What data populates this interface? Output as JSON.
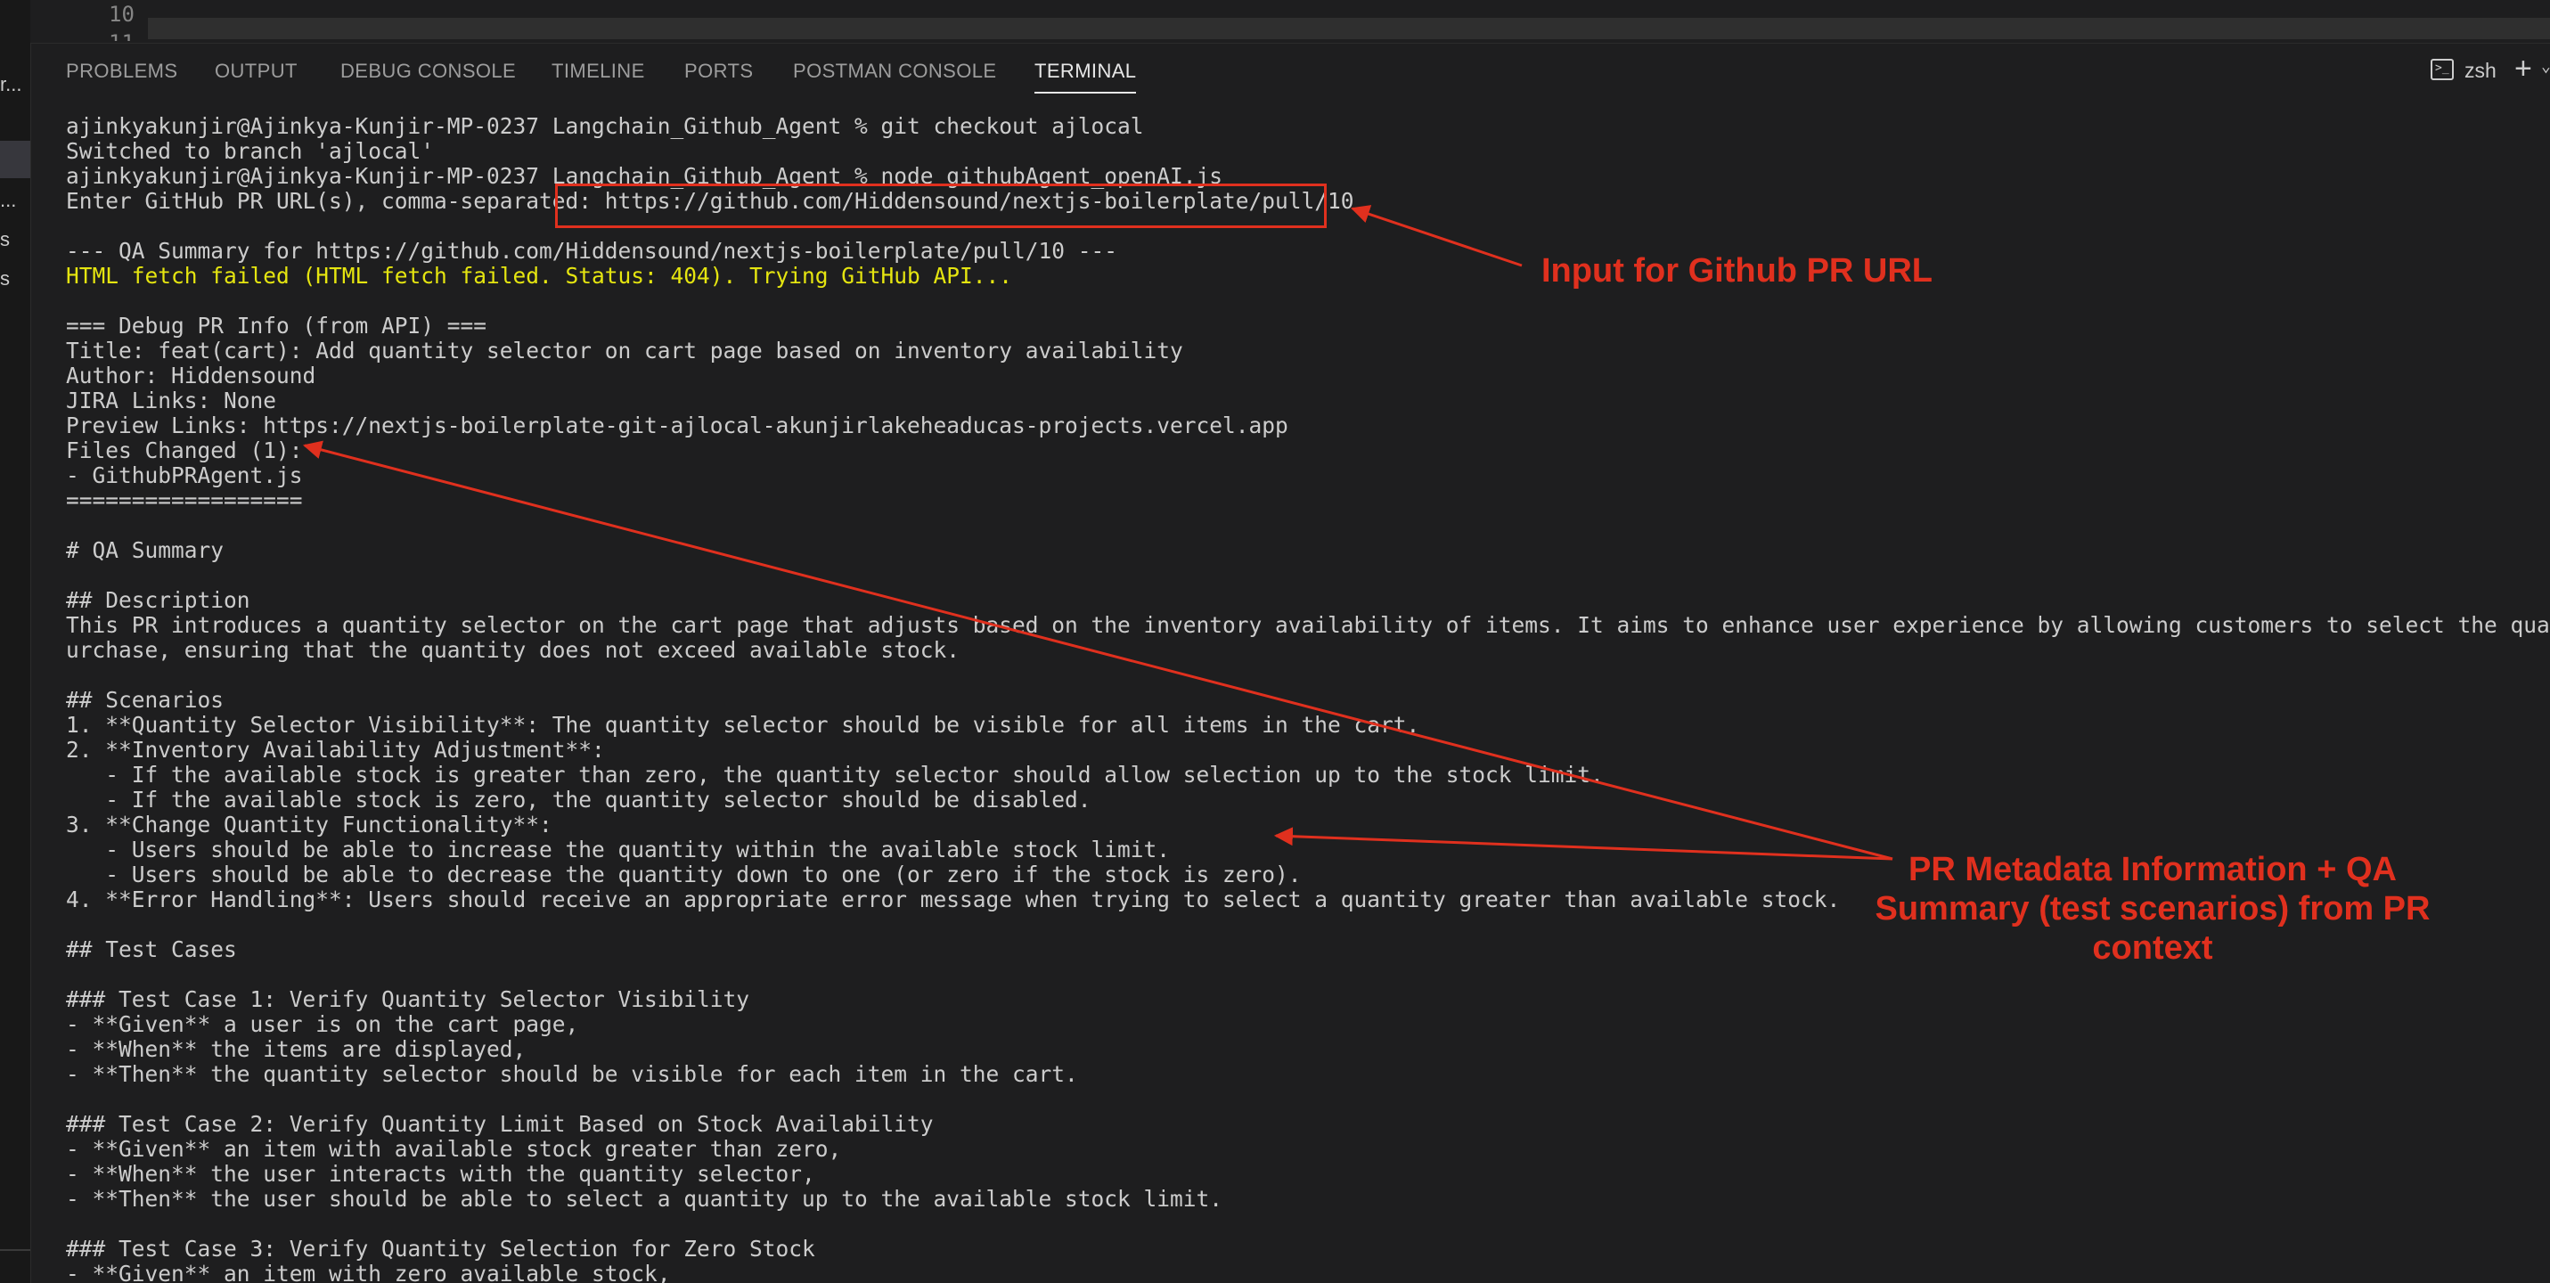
{
  "editor": {
    "line_number": "10",
    "line_number_next": "11"
  },
  "activity_fragments": [
    "r...",
    "...",
    "s",
    "s"
  ],
  "panel": {
    "tabs": [
      "PROBLEMS",
      "OUTPUT",
      "DEBUG CONSOLE",
      "TIMELINE",
      "PORTS",
      "POSTMAN CONSOLE",
      "TERMINAL"
    ],
    "active_tab": "TERMINAL",
    "shell_name": "zsh",
    "shell_icon": "terminal-icon",
    "add_icon": "plus-icon"
  },
  "terminal": {
    "lines": [
      "ajinkyakunjir@Ajinkya-Kunjir-MP-0237 Langchain_Github_Agent % git checkout ajlocal",
      "Switched to branch 'ajlocal'",
      "ajinkyakunjir@Ajinkya-Kunjir-MP-0237 Langchain_Github_Agent % node githubAgent_openAI.js",
      "Enter GitHub PR URL(s), comma-separated: https://github.com/Hiddensound/nextjs-boilerplate/pull/10",
      "",
      "--- QA Summary for https://github.com/Hiddensound/nextjs-boilerplate/pull/10 ---",
      "HTML fetch failed (HTML fetch failed. Status: 404). Trying GitHub API...",
      "",
      "=== Debug PR Info (from API) ===",
      "Title: feat(cart): Add quantity selector on cart page based on inventory availability",
      "Author: Hiddensound",
      "JIRA Links: None",
      "Preview Links: https://nextjs-boilerplate-git-ajlocal-akunjirlakeheaducas-projects.vercel.app",
      "Files Changed (1):",
      "- GithubPRAgent.js",
      "==================",
      "",
      "# QA Summary",
      "",
      "## Description",
      "This PR introduces a quantity selector on the cart page that adjusts based on the inventory availability of items. It aims to enhance user experience by allowing customers to select the quantity of i",
      "urchase, ensuring that the quantity does not exceed available stock.",
      "",
      "## Scenarios",
      "1. **Quantity Selector Visibility**: The quantity selector should be visible for all items in the cart.",
      "2. **Inventory Availability Adjustment**:",
      "   - If the available stock is greater than zero, the quantity selector should allow selection up to the stock limit.",
      "   - If the available stock is zero, the quantity selector should be disabled.",
      "3. **Change Quantity Functionality**:",
      "   - Users should be able to increase the quantity within the available stock limit.",
      "   - Users should be able to decrease the quantity down to one (or zero if the stock is zero).",
      "4. **Error Handling**: Users should receive an appropriate error message when trying to select a quantity greater than available stock.",
      "",
      "## Test Cases",
      "",
      "### Test Case 1: Verify Quantity Selector Visibility",
      "- **Given** a user is on the cart page,",
      "- **When** the items are displayed,",
      "- **Then** the quantity selector should be visible for each item in the cart.",
      "",
      "### Test Case 2: Verify Quantity Limit Based on Stock Availability",
      "- **Given** an item with available stock greater than zero,",
      "- **When** the user interacts with the quantity selector,",
      "- **Then** the user should be able to select a quantity up to the available stock limit.",
      "",
      "### Test Case 3: Verify Quantity Selection for Zero Stock",
      "- **Given** an item with zero available stock,"
    ],
    "warning_line_index": 6
  },
  "annotations": {
    "url_label": "Input for Github PR URL",
    "metadata_label_lines": [
      "PR Metadata Information + QA",
      "Summary (test scenarios) from PR",
      "context"
    ],
    "color": "#e0301e"
  }
}
